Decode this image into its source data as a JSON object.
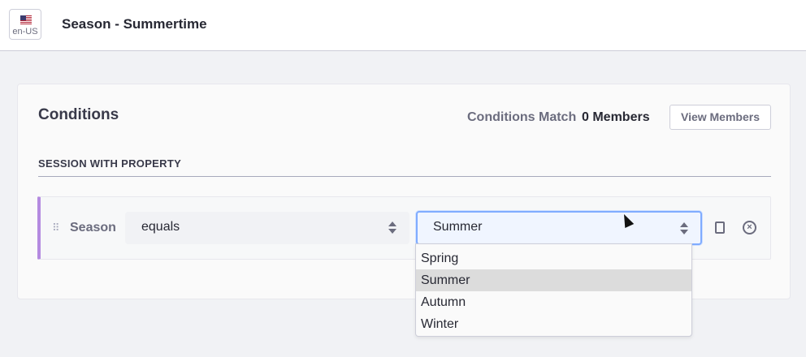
{
  "header": {
    "locale": "en-US",
    "title": "Season - Summertime"
  },
  "conditions": {
    "title": "Conditions",
    "match_label": "Conditions Match",
    "match_count": "0 Members",
    "view_members_label": "View Members",
    "section_label": "SESSION WITH PROPERTY",
    "criterion": {
      "property": "Season",
      "operator": "equals",
      "value": "Summer"
    }
  },
  "dropdown": {
    "options": [
      "Spring",
      "Summer",
      "Autumn",
      "Winter"
    ],
    "selected": "Summer"
  },
  "colors": {
    "accent": "#80acff",
    "criterion_border": "#b48ae0"
  }
}
